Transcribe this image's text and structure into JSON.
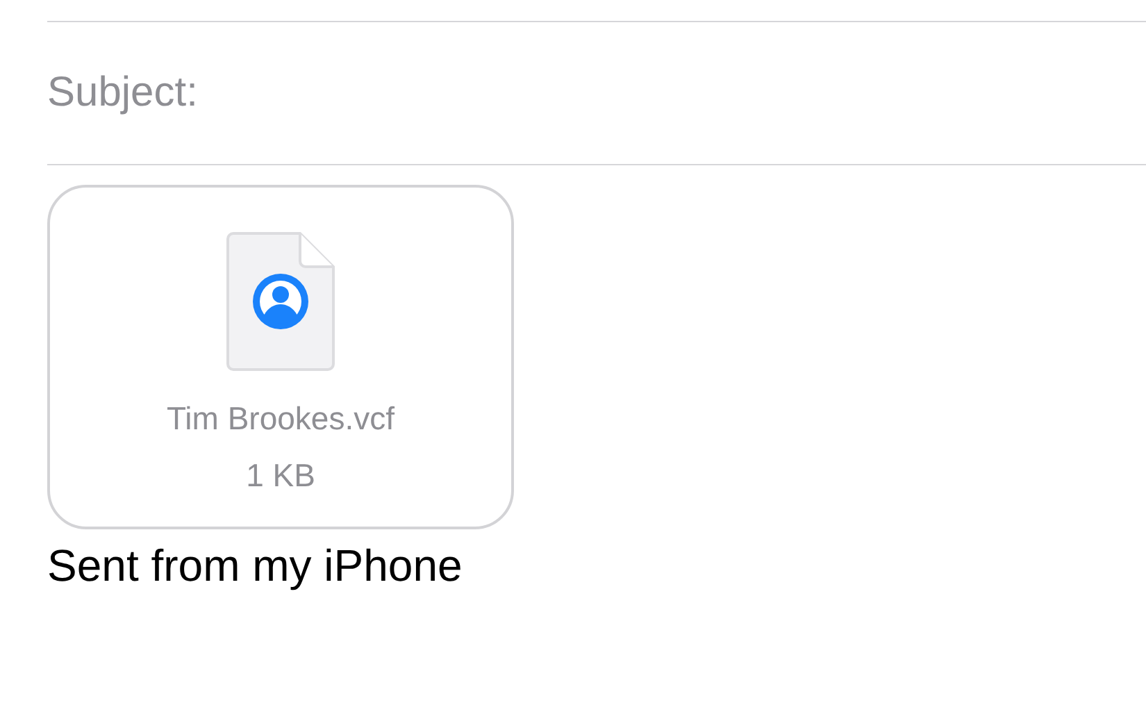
{
  "subject": {
    "label": "Subject:"
  },
  "attachment": {
    "filename": "Tim Brookes.vcf",
    "size": "1 KB"
  },
  "signature": "Sent from my iPhone"
}
